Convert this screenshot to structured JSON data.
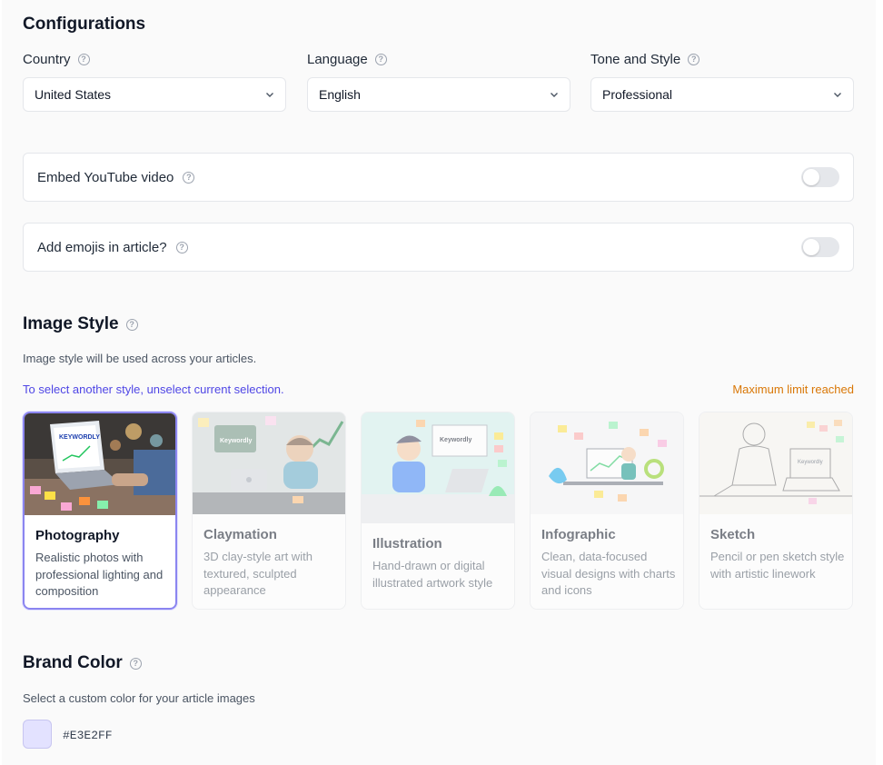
{
  "config": {
    "title": "Configurations",
    "country": {
      "label": "Country",
      "value": "United States"
    },
    "language": {
      "label": "Language",
      "value": "English"
    },
    "tone": {
      "label": "Tone and Style",
      "value": "Professional"
    }
  },
  "toggles": {
    "youtube": {
      "label": "Embed YouTube video",
      "on": false
    },
    "emojis": {
      "label": "Add emojis in article?",
      "on": false
    }
  },
  "image_style": {
    "title": "Image Style",
    "subtitle": "Image style will be used across your articles.",
    "hint": "To select another style, unselect current selection.",
    "limit": "Maximum limit reached",
    "cards": [
      {
        "name": "Photography",
        "desc": "Realistic photos with professional lighting and composition",
        "selected": true
      },
      {
        "name": "Claymation",
        "desc": "3D clay-style art with textured, sculpted appearance",
        "selected": false
      },
      {
        "name": "Illustration",
        "desc": "Hand-drawn or digital illustrated artwork style",
        "selected": false
      },
      {
        "name": "Infographic",
        "desc": "Clean, data-focused visual designs with charts and icons",
        "selected": false
      },
      {
        "name": "Sketch",
        "desc": "Pencil or pen sketch style with artistic linework",
        "selected": false
      }
    ]
  },
  "brand": {
    "title": "Brand Color",
    "subtitle": "Select a custom color for your article images",
    "value": "#E3E2FF"
  },
  "colors": {
    "accent": "#8b85f0",
    "hint": "#4f46e5",
    "warning": "#d97706"
  }
}
